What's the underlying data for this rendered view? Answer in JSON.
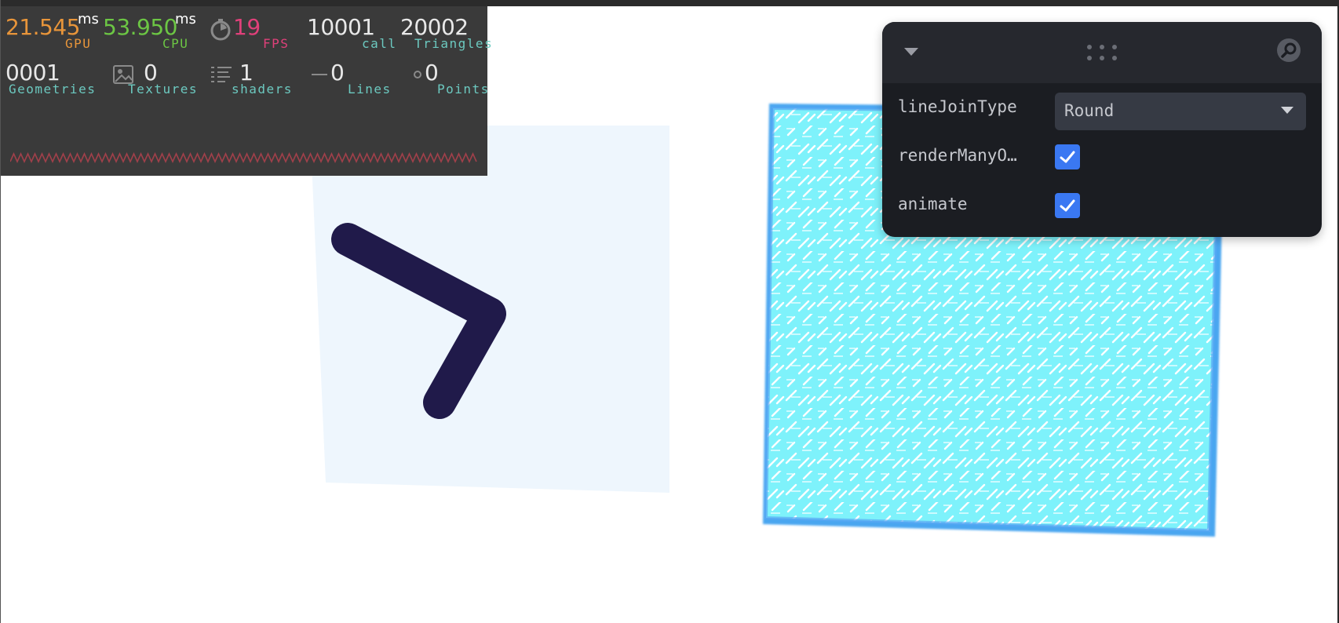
{
  "stats": {
    "gpu": {
      "value": "21.545",
      "unit": "ms",
      "label": "GPU",
      "color": "#e8953a"
    },
    "cpu": {
      "value": "53.950",
      "unit": "ms",
      "label": "CPU",
      "color": "#6cc644"
    },
    "fps": {
      "value": "19",
      "label": "FPS",
      "color": "#e0407a"
    },
    "calls": {
      "value": "10001",
      "label": "call"
    },
    "triangles": {
      "value": "20002",
      "label": "Triangles"
    },
    "geometries": {
      "value": "0001",
      "label": "Geometries"
    },
    "textures": {
      "value": "0",
      "label": "Textures"
    },
    "shaders": {
      "value": "1",
      "label": "shaders"
    },
    "lines": {
      "value": "0",
      "label": "Lines"
    },
    "points": {
      "value": "0",
      "label": "Points"
    },
    "label_color": "#6cc9c0",
    "wave_color": "#a0404a"
  },
  "gui": {
    "rows": [
      {
        "label": "lineJoinType",
        "type": "select",
        "value": "Round"
      },
      {
        "label": "renderManyO…",
        "type": "checkbox",
        "checked": true
      },
      {
        "label": "animate",
        "type": "checkbox",
        "checked": true
      }
    ],
    "accent": "#3a78f2"
  },
  "scene": {
    "stroke_color": "#201a4a",
    "plane_color": "#eef6fd",
    "texture_color": "#7ef2fb"
  }
}
